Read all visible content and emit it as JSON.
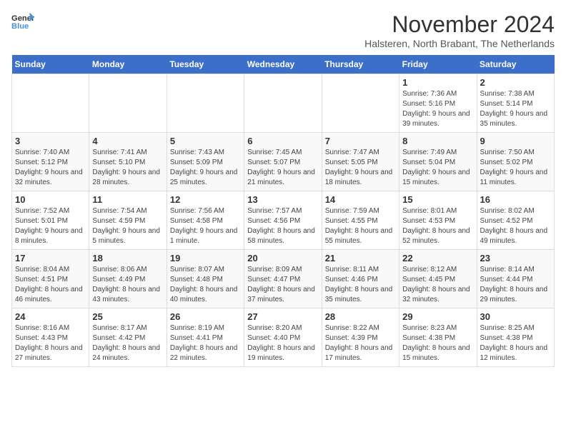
{
  "logo": {
    "text_general": "General",
    "text_blue": "Blue"
  },
  "title": "November 2024",
  "subtitle": "Halsteren, North Brabant, The Netherlands",
  "days_of_week": [
    "Sunday",
    "Monday",
    "Tuesday",
    "Wednesday",
    "Thursday",
    "Friday",
    "Saturday"
  ],
  "weeks": [
    [
      {
        "day": "",
        "info": ""
      },
      {
        "day": "",
        "info": ""
      },
      {
        "day": "",
        "info": ""
      },
      {
        "day": "",
        "info": ""
      },
      {
        "day": "",
        "info": ""
      },
      {
        "day": "1",
        "info": "Sunrise: 7:36 AM\nSunset: 5:16 PM\nDaylight: 9 hours and 39 minutes."
      },
      {
        "day": "2",
        "info": "Sunrise: 7:38 AM\nSunset: 5:14 PM\nDaylight: 9 hours and 35 minutes."
      }
    ],
    [
      {
        "day": "3",
        "info": "Sunrise: 7:40 AM\nSunset: 5:12 PM\nDaylight: 9 hours and 32 minutes."
      },
      {
        "day": "4",
        "info": "Sunrise: 7:41 AM\nSunset: 5:10 PM\nDaylight: 9 hours and 28 minutes."
      },
      {
        "day": "5",
        "info": "Sunrise: 7:43 AM\nSunset: 5:09 PM\nDaylight: 9 hours and 25 minutes."
      },
      {
        "day": "6",
        "info": "Sunrise: 7:45 AM\nSunset: 5:07 PM\nDaylight: 9 hours and 21 minutes."
      },
      {
        "day": "7",
        "info": "Sunrise: 7:47 AM\nSunset: 5:05 PM\nDaylight: 9 hours and 18 minutes."
      },
      {
        "day": "8",
        "info": "Sunrise: 7:49 AM\nSunset: 5:04 PM\nDaylight: 9 hours and 15 minutes."
      },
      {
        "day": "9",
        "info": "Sunrise: 7:50 AM\nSunset: 5:02 PM\nDaylight: 9 hours and 11 minutes."
      }
    ],
    [
      {
        "day": "10",
        "info": "Sunrise: 7:52 AM\nSunset: 5:01 PM\nDaylight: 9 hours and 8 minutes."
      },
      {
        "day": "11",
        "info": "Sunrise: 7:54 AM\nSunset: 4:59 PM\nDaylight: 9 hours and 5 minutes."
      },
      {
        "day": "12",
        "info": "Sunrise: 7:56 AM\nSunset: 4:58 PM\nDaylight: 9 hours and 1 minute."
      },
      {
        "day": "13",
        "info": "Sunrise: 7:57 AM\nSunset: 4:56 PM\nDaylight: 8 hours and 58 minutes."
      },
      {
        "day": "14",
        "info": "Sunrise: 7:59 AM\nSunset: 4:55 PM\nDaylight: 8 hours and 55 minutes."
      },
      {
        "day": "15",
        "info": "Sunrise: 8:01 AM\nSunset: 4:53 PM\nDaylight: 8 hours and 52 minutes."
      },
      {
        "day": "16",
        "info": "Sunrise: 8:02 AM\nSunset: 4:52 PM\nDaylight: 8 hours and 49 minutes."
      }
    ],
    [
      {
        "day": "17",
        "info": "Sunrise: 8:04 AM\nSunset: 4:51 PM\nDaylight: 8 hours and 46 minutes."
      },
      {
        "day": "18",
        "info": "Sunrise: 8:06 AM\nSunset: 4:49 PM\nDaylight: 8 hours and 43 minutes."
      },
      {
        "day": "19",
        "info": "Sunrise: 8:07 AM\nSunset: 4:48 PM\nDaylight: 8 hours and 40 minutes."
      },
      {
        "day": "20",
        "info": "Sunrise: 8:09 AM\nSunset: 4:47 PM\nDaylight: 8 hours and 37 minutes."
      },
      {
        "day": "21",
        "info": "Sunrise: 8:11 AM\nSunset: 4:46 PM\nDaylight: 8 hours and 35 minutes."
      },
      {
        "day": "22",
        "info": "Sunrise: 8:12 AM\nSunset: 4:45 PM\nDaylight: 8 hours and 32 minutes."
      },
      {
        "day": "23",
        "info": "Sunrise: 8:14 AM\nSunset: 4:44 PM\nDaylight: 8 hours and 29 minutes."
      }
    ],
    [
      {
        "day": "24",
        "info": "Sunrise: 8:16 AM\nSunset: 4:43 PM\nDaylight: 8 hours and 27 minutes."
      },
      {
        "day": "25",
        "info": "Sunrise: 8:17 AM\nSunset: 4:42 PM\nDaylight: 8 hours and 24 minutes."
      },
      {
        "day": "26",
        "info": "Sunrise: 8:19 AM\nSunset: 4:41 PM\nDaylight: 8 hours and 22 minutes."
      },
      {
        "day": "27",
        "info": "Sunrise: 8:20 AM\nSunset: 4:40 PM\nDaylight: 8 hours and 19 minutes."
      },
      {
        "day": "28",
        "info": "Sunrise: 8:22 AM\nSunset: 4:39 PM\nDaylight: 8 hours and 17 minutes."
      },
      {
        "day": "29",
        "info": "Sunrise: 8:23 AM\nSunset: 4:38 PM\nDaylight: 8 hours and 15 minutes."
      },
      {
        "day": "30",
        "info": "Sunrise: 8:25 AM\nSunset: 4:38 PM\nDaylight: 8 hours and 12 minutes."
      }
    ]
  ]
}
